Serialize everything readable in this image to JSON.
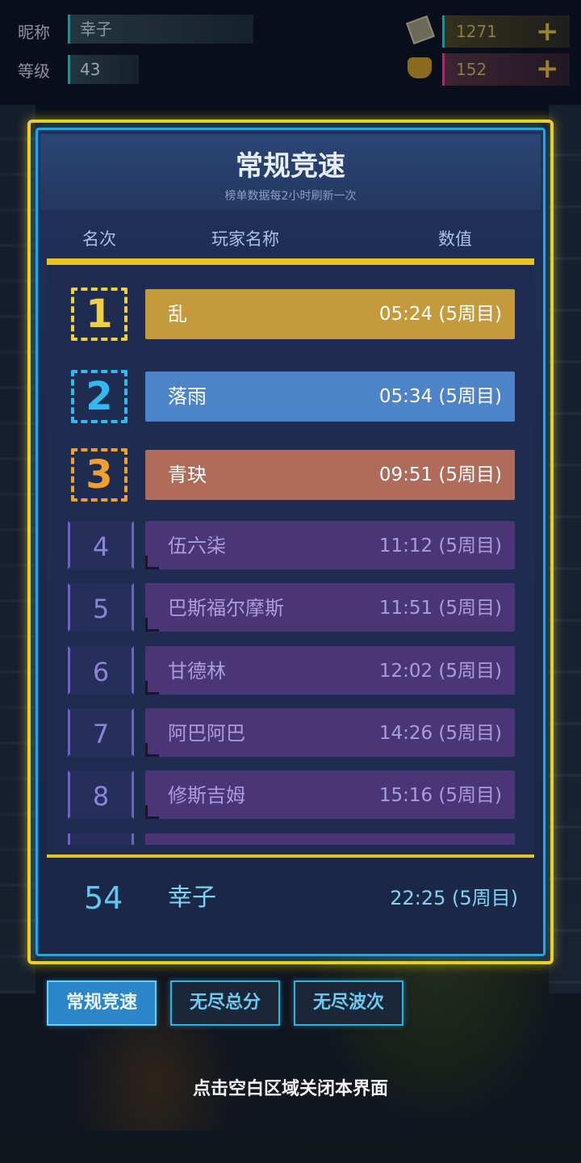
{
  "topbar": {
    "nickname_label": "昵称",
    "nickname_value": "幸子",
    "level_label": "等级",
    "level_value": "43",
    "currency1_value": "1271",
    "currency1_icon": "coin-icon",
    "currency2_value": "152",
    "currency2_icon": "cat-icon",
    "plus_symbol": "+"
  },
  "panel": {
    "title": "常规竞速",
    "subtitle": "榜单数据每2小时刷新一次",
    "columns": {
      "rank": "名次",
      "player": "玩家名称",
      "value": "数值"
    },
    "entries": [
      {
        "rank": "1",
        "name": "乱",
        "value": "05:24 (5周目)"
      },
      {
        "rank": "2",
        "name": "落雨",
        "value": "05:34 (5周目)"
      },
      {
        "rank": "3",
        "name": "青玦",
        "value": "09:51 (5周目)"
      },
      {
        "rank": "4",
        "name": "伍六柒",
        "value": "11:12 (5周目)"
      },
      {
        "rank": "5",
        "name": "巴斯福尔摩斯",
        "value": "11:51 (5周目)"
      },
      {
        "rank": "6",
        "name": "甘德林",
        "value": "12:02 (5周目)"
      },
      {
        "rank": "7",
        "name": "阿巴阿巴",
        "value": "14:26 (5周目)"
      },
      {
        "rank": "8",
        "name": "修斯吉姆",
        "value": "15:16 (5周目)"
      }
    ],
    "my_entry": {
      "rank": "54",
      "name": "幸子",
      "value": "22:25 (5周目)"
    }
  },
  "tabs": [
    {
      "label": "常规竞速",
      "active": true
    },
    {
      "label": "无尽总分",
      "active": false
    },
    {
      "label": "无尽波次",
      "active": false
    }
  ],
  "hint": "点击空白区域关闭本界面",
  "colors": {
    "frame_gold": "#f1d21e",
    "frame_blue": "#1fa8e8",
    "rank1": "#c49a3a",
    "rank2": "#4d84c9",
    "rank3": "#b06b5a",
    "rank_other": "#4a3677"
  }
}
